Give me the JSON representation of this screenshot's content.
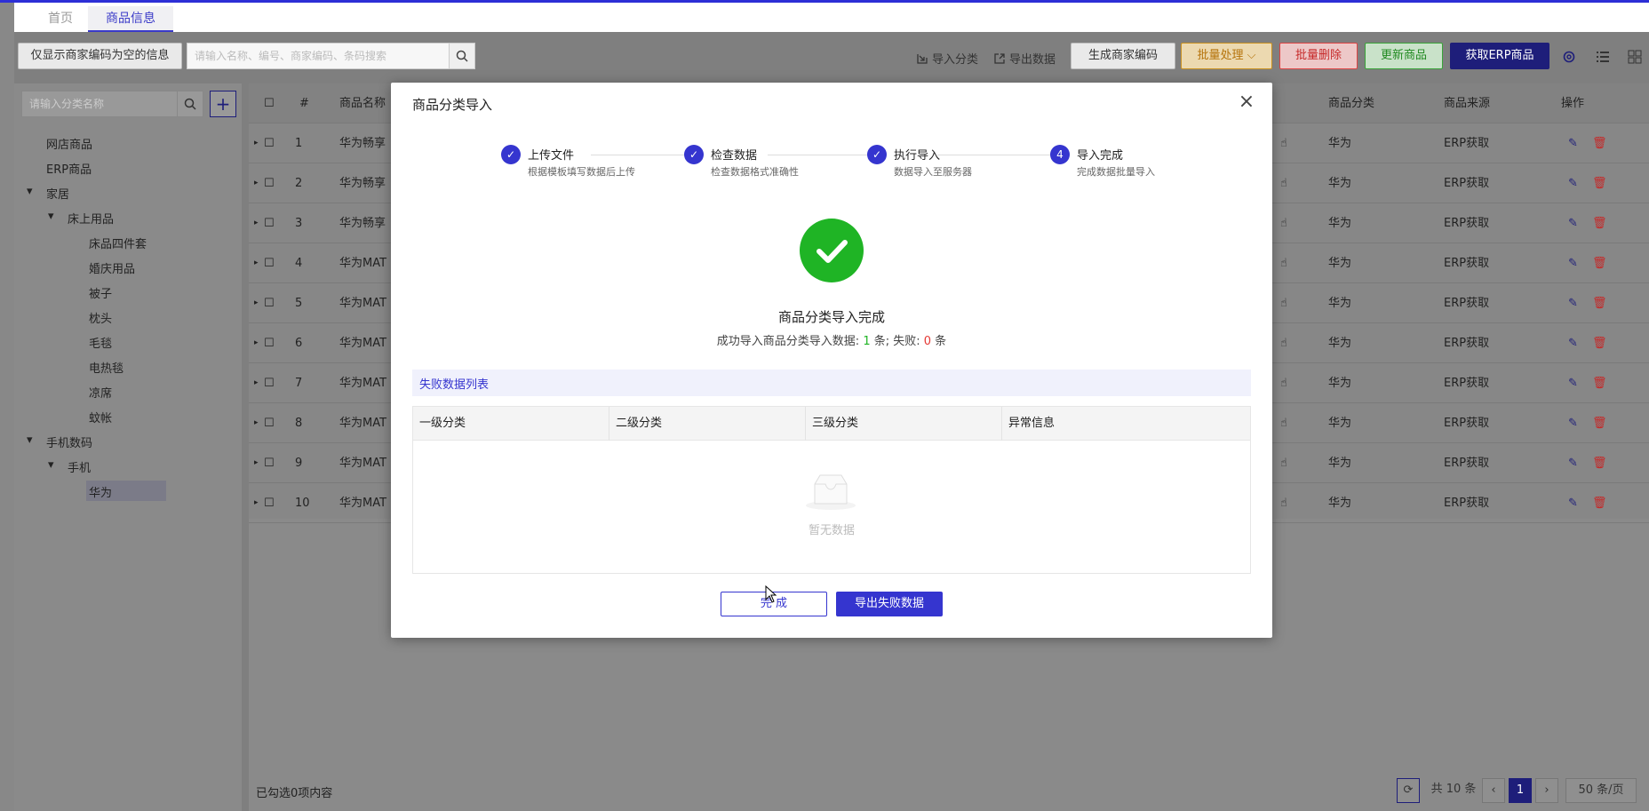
{
  "tabs": [
    {
      "label": "首页"
    },
    {
      "label": "商品信息"
    }
  ],
  "toolbar": {
    "filter_empty_btn": "仅显示商家编码为空的信息",
    "search_placeholder": "请输入名称、编号、商家编码、条码搜索",
    "import_category": "导入分类",
    "export_data": "导出数据",
    "gen_code": "生成商家编码",
    "batch_process": "批量处理",
    "batch_delete": "批量删除",
    "update_goods": "更新商品",
    "fetch_erp": "获取ERP商品"
  },
  "sidebar": {
    "search_placeholder": "请输入分类名称",
    "items": [
      "网店商品",
      "ERP商品",
      "家居",
      "床上用品",
      "床品四件套",
      "婚庆用品",
      "被子",
      "枕头",
      "毛毯",
      "电热毯",
      "凉席",
      "蚊帐",
      "手机数码",
      "手机",
      "华为"
    ]
  },
  "table": {
    "headers": {
      "index": "#",
      "name": "商品名称",
      "category": "商品分类",
      "source": "商品来源",
      "ops": "操作"
    },
    "rows": [
      {
        "index": "1",
        "name": "华为畅享",
        "category": "华为",
        "source": "ERP获取"
      },
      {
        "index": "2",
        "name": "华为畅享",
        "category": "华为",
        "source": "ERP获取"
      },
      {
        "index": "3",
        "name": "华为畅享",
        "category": "华为",
        "source": "ERP获取"
      },
      {
        "index": "4",
        "name": "华为MAT",
        "category": "华为",
        "source": "ERP获取"
      },
      {
        "index": "5",
        "name": "华为MAT",
        "category": "华为",
        "source": "ERP获取"
      },
      {
        "index": "6",
        "name": "华为MAT",
        "category": "华为",
        "source": "ERP获取"
      },
      {
        "index": "7",
        "name": "华为MAT",
        "category": "华为",
        "source": "ERP获取"
      },
      {
        "index": "8",
        "name": "华为MAT",
        "category": "华为",
        "source": "ERP获取"
      },
      {
        "index": "9",
        "name": "华为MAT",
        "category": "华为",
        "source": "ERP获取"
      },
      {
        "index": "10",
        "name": "华为MAT",
        "category": "华为",
        "source": "ERP获取"
      }
    ]
  },
  "footer": {
    "selected": "已勾选0项内容",
    "total": "共 10 条",
    "page": "1",
    "page_size": "50 条/页"
  },
  "modal": {
    "title": "商品分类导入",
    "steps": [
      {
        "title": "上传文件",
        "desc": "根据模板填写数据后上传",
        "mark": "check"
      },
      {
        "title": "检查数据",
        "desc": "检查数据格式准确性",
        "mark": "check"
      },
      {
        "title": "执行导入",
        "desc": "数据导入至服务器",
        "mark": "check"
      },
      {
        "title": "导入完成",
        "desc": "完成数据批量导入",
        "mark": "4"
      }
    ],
    "result_title": "商品分类导入完成",
    "result_prefix": "成功导入商品分类导入数据: ",
    "success_count": "1",
    "mid_text": " 条; 失败: ",
    "fail_count": "0",
    "suffix": " 条",
    "fail_list_title": "失败数据列表",
    "fail_columns": [
      "一级分类",
      "二级分类",
      "三级分类",
      "异常信息"
    ],
    "empty_text": "暂无数据",
    "done_btn": "完 成",
    "export_fail_btn": "导出失败数据"
  },
  "colors": {
    "primary": "#3535cf",
    "success": "#1fb425",
    "danger": "#e53935",
    "warning": "#d98c00"
  }
}
